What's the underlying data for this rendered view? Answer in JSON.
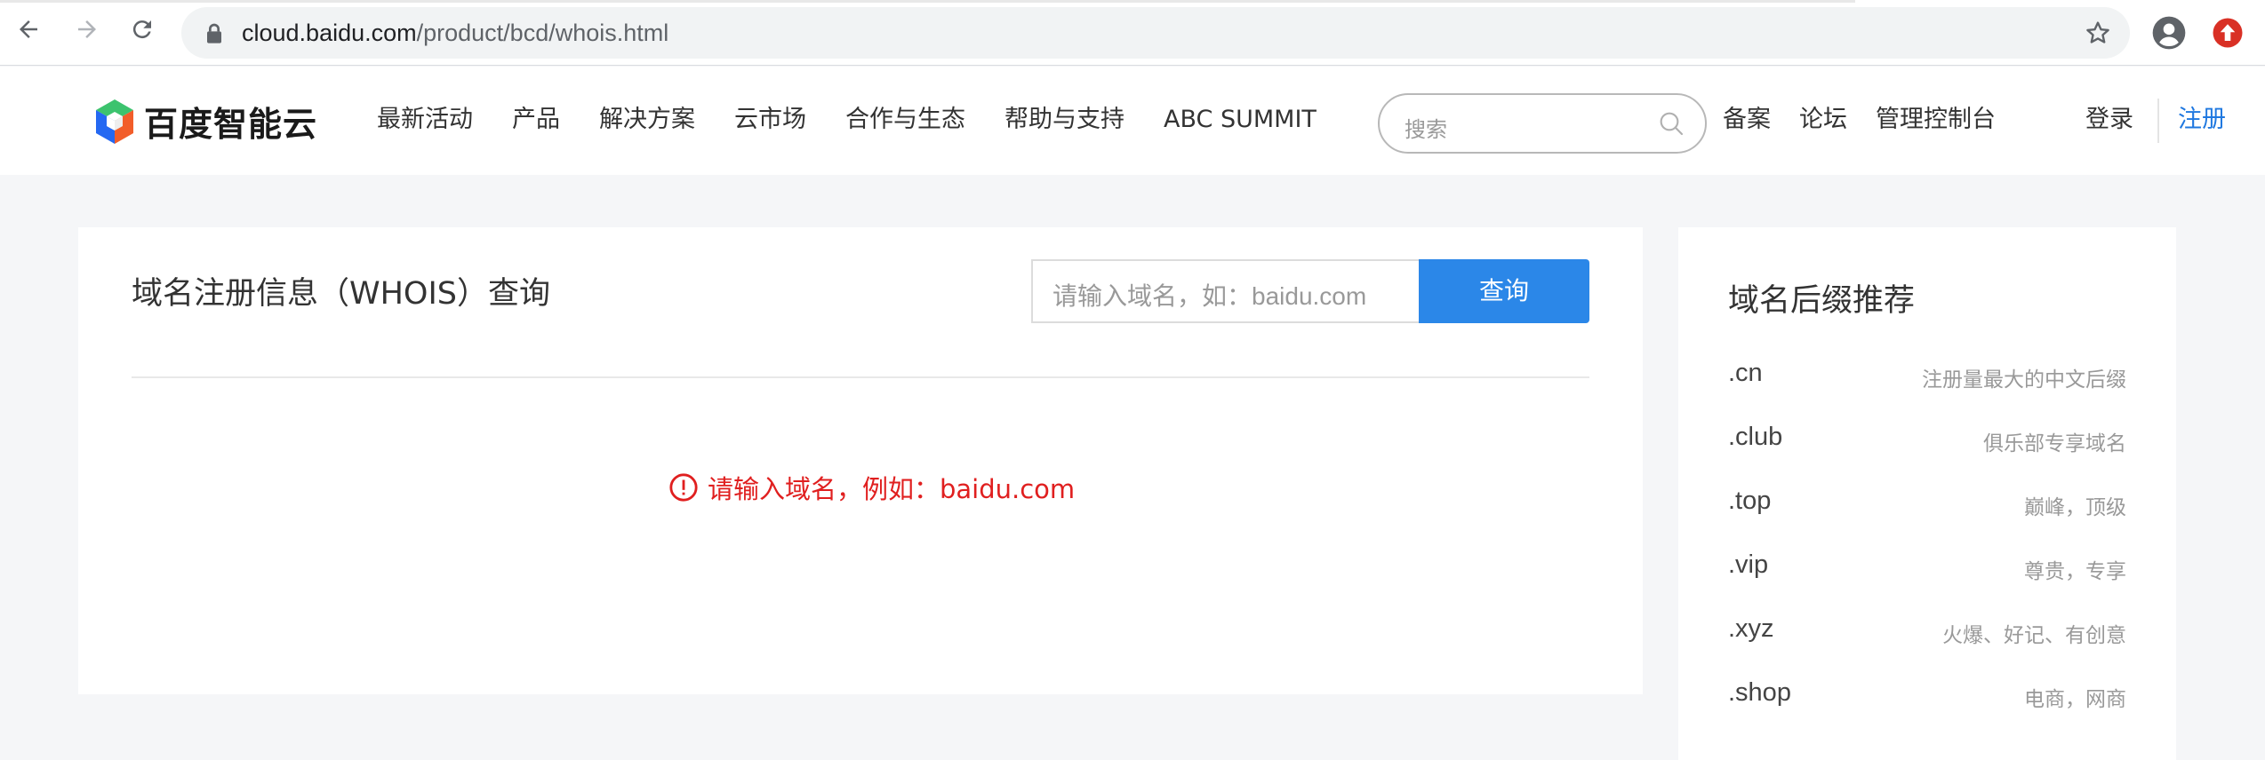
{
  "browser": {
    "url_host": "cloud.baidu.com",
    "url_path": "/product/bcd/whois.html",
    "icons": [
      "back-icon",
      "forward-icon",
      "reload-icon",
      "lock-icon",
      "star-icon",
      "profile-icon",
      "update-icon"
    ]
  },
  "header": {
    "logo_text": "百度智能云",
    "nav": [
      "最新活动",
      "产品",
      "解决方案",
      "云市场",
      "合作与生态",
      "帮助与支持",
      "ABC SUMMIT"
    ],
    "search_placeholder": "搜索",
    "right_nav": [
      "备案",
      "论坛",
      "管理控制台"
    ],
    "login": "登录",
    "register": "注册",
    "accent_color": "#1f78e0"
  },
  "main": {
    "title": "域名注册信息（WHOIS）查询",
    "input_placeholder": "请输入域名，如：baidu.com",
    "query_button": "查询",
    "error_message": "请输入域名，例如：baidu.com",
    "error_color": "#e01f1f"
  },
  "sidebar": {
    "title": "域名后缀推荐",
    "items": [
      {
        "name": ".cn",
        "desc": "注册量最大的中文后缀"
      },
      {
        "name": ".club",
        "desc": "俱乐部专享域名"
      },
      {
        "name": ".top",
        "desc": "巅峰，顶级"
      },
      {
        "name": ".vip",
        "desc": "尊贵，专享"
      },
      {
        "name": ".xyz",
        "desc": "火爆、好记、有创意"
      },
      {
        "name": ".shop",
        "desc": "电商，网商"
      }
    ]
  }
}
